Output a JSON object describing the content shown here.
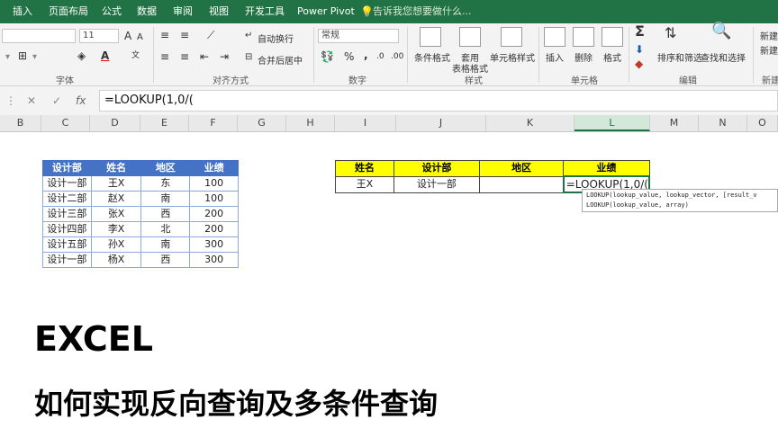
{
  "tabs": [
    "插入",
    "页面布局",
    "公式",
    "数据",
    "审阅",
    "视图",
    "开发工具",
    "Power Pivot"
  ],
  "tell_me": "告诉我您想要做什么...",
  "ribbon": {
    "font_size": "11",
    "font_size_up": "A",
    "font_size_down": "A",
    "wrap_text": "自动换行",
    "merge_center": "合并后居中",
    "number_format": "常规",
    "percent": "%",
    "comma": ",",
    "conditional_format": "条件格式",
    "table_format_1": "套用",
    "table_format_2": "表格格式",
    "cell_style": "单元格样式",
    "insert": "插入",
    "delete": "删除",
    "format": "格式",
    "sort_filter": "排序和筛选",
    "find_select": "查找和选择",
    "share": "新建",
    "share2": "新建",
    "groups": {
      "font": "字体",
      "alignment": "对齐方式",
      "number": "数字",
      "styles": "样式",
      "cells": "单元格",
      "editing": "编辑",
      "new": "新建"
    }
  },
  "formula_bar": {
    "cancel": "✕",
    "confirm": "✓",
    "fx": "fx",
    "content": "=LOOKUP(1,0/("
  },
  "columns": [
    "B",
    "C",
    "D",
    "E",
    "F",
    "G",
    "H",
    "I",
    "J",
    "K",
    "L",
    "M",
    "N",
    "O"
  ],
  "active_column": "L",
  "left_table": {
    "headers": [
      "设计部",
      "姓名",
      "地区",
      "业绩"
    ],
    "rows": [
      [
        "设计一部",
        "王X",
        "东",
        "100"
      ],
      [
        "设计二部",
        "赵X",
        "南",
        "100"
      ],
      [
        "设计三部",
        "张X",
        "西",
        "200"
      ],
      [
        "设计四部",
        "李X",
        "北",
        "200"
      ],
      [
        "设计五部",
        "孙X",
        "南",
        "300"
      ],
      [
        "设计一部",
        "杨X",
        "西",
        "300"
      ]
    ]
  },
  "right_table": {
    "headers": [
      "姓名",
      "设计部",
      "地区",
      "业绩"
    ],
    "row": [
      "王X",
      "设计一部",
      "",
      "=LOOKUP(1,0/("
    ]
  },
  "tooltip": {
    "line1": "LOOKUP(lookup_value, lookup_vector, [result_v",
    "line2": "LOOKUP(lookup_value, array)"
  },
  "overlay": {
    "title": "EXCEL",
    "subtitle": "如何实现反向查询及多条件查询"
  },
  "colors": {
    "excel_green": "#217346",
    "header_blue": "#4472c4",
    "header_yellow": "#ffff00"
  }
}
